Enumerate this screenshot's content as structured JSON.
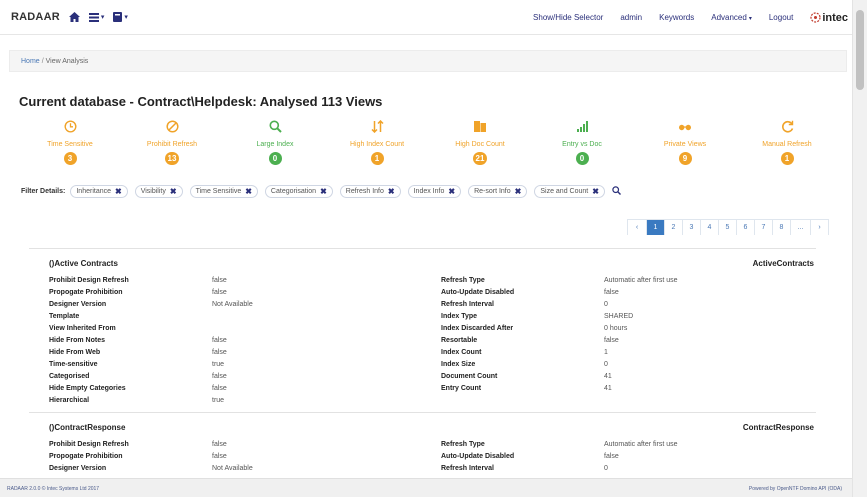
{
  "nav": {
    "brand": "RADAAR",
    "links": [
      "Show/Hide Selector",
      "admin",
      "Keywords",
      "Advanced",
      "Logout"
    ],
    "logo_text": "intec"
  },
  "breadcrumb": {
    "home": "Home",
    "sep": "/",
    "current": "View Analysis"
  },
  "title": "Current database - Contract\\Helpdesk: Analysed 113 Views",
  "stats": [
    {
      "label": "Time Sensitive",
      "count": "3",
      "icon": "clock-icon",
      "color": "#f0a329"
    },
    {
      "label": "Prohibit Refresh",
      "count": "13",
      "icon": "ban-icon",
      "color": "#f0a329"
    },
    {
      "label": "Large Index",
      "count": "0",
      "icon": "search-icon",
      "color": "#4caf50"
    },
    {
      "label": "High Index Count",
      "count": "1",
      "icon": "sort-icon",
      "color": "#f0a329"
    },
    {
      "label": "High Doc Count",
      "count": "21",
      "icon": "docs-icon",
      "color": "#f0a329"
    },
    {
      "label": "Entry vs Doc",
      "count": "0",
      "icon": "bar-chart-icon",
      "color": "#4caf50"
    },
    {
      "label": "Private Views",
      "count": "9",
      "icon": "glasses-icon",
      "color": "#f0a329"
    },
    {
      "label": "Manual Refresh",
      "count": "1",
      "icon": "refresh-icon",
      "color": "#f0a329"
    }
  ],
  "filter": {
    "label": "Filter Details:",
    "chips": [
      "Inheritance",
      "Visibility",
      "Time Sensitive",
      "Categorisation",
      "Refresh Info",
      "Index Info",
      "Re-sort Info",
      "Size and Count"
    ]
  },
  "pagination": [
    "‹",
    "1",
    "2",
    "3",
    "4",
    "5",
    "6",
    "7",
    "8",
    "...",
    "›"
  ],
  "records": [
    {
      "title": "()Active Contracts",
      "alias": "ActiveContracts",
      "left": [
        [
          "Prohibit Design Refresh",
          "false"
        ],
        [
          "Propogate Prohibition",
          "false"
        ],
        [
          "Designer Version",
          "Not Available"
        ],
        [
          "Template",
          ""
        ],
        [
          "View Inherited From",
          ""
        ],
        [
          "Hide From Notes",
          "false"
        ],
        [
          "Hide From Web",
          "false"
        ],
        [
          "Time-sensitive",
          "true"
        ],
        [
          "Categorised",
          "false"
        ],
        [
          "Hide Empty Categories",
          "false"
        ],
        [
          "Hierarchical",
          "true"
        ]
      ],
      "right": [
        [
          "Refresh Type",
          "Automatic after first use"
        ],
        [
          "Auto-Update Disabled",
          "false"
        ],
        [
          "Refresh Interval",
          "0"
        ],
        [
          "Index Type",
          "SHARED"
        ],
        [
          "Index Discarded After",
          "0 hours"
        ],
        [
          "Resortable",
          "false"
        ],
        [
          "Index Count",
          "1"
        ],
        [
          "Index Size",
          "0"
        ],
        [
          "Document Count",
          "41"
        ],
        [
          "Entry Count",
          "41"
        ]
      ]
    },
    {
      "title": "()ContractResponse",
      "alias": "ContractResponse",
      "left": [
        [
          "Prohibit Design Refresh",
          "false"
        ],
        [
          "Propogate Prohibition",
          "false"
        ],
        [
          "Designer Version",
          "Not Available"
        ]
      ],
      "right": [
        [
          "Refresh Type",
          "Automatic after first use"
        ],
        [
          "Auto-Update Disabled",
          "false"
        ],
        [
          "Refresh Interval",
          "0"
        ]
      ]
    }
  ],
  "footer": {
    "left": "RADAAR 2.0.0 © Intec Systems Ltd 2017",
    "right": "Powered by OpenNTF Domino API (ODA)"
  }
}
